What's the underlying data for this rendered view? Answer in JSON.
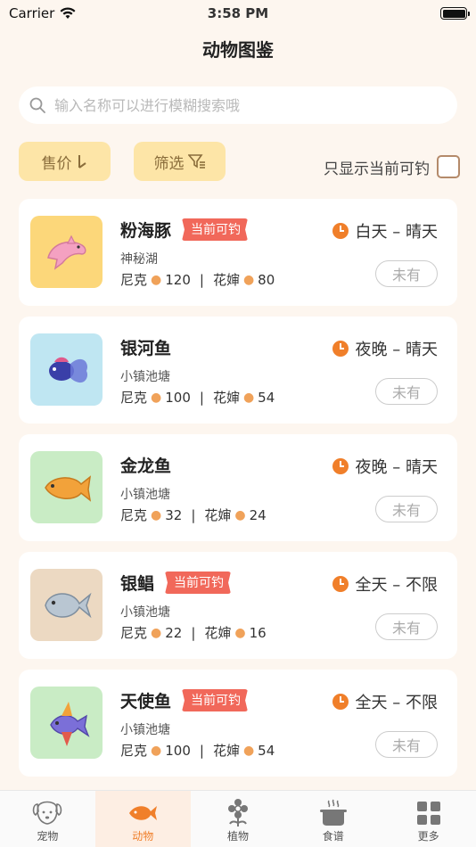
{
  "status": {
    "carrier": "Carrier",
    "time": "3:58 PM"
  },
  "nav": {
    "title": "动物图鉴"
  },
  "search": {
    "placeholder": "输入名称可以进行模糊搜索哦"
  },
  "filters": {
    "price_label": "售价",
    "filter_label": "筛选",
    "only_current_label": "只显示当前可钓"
  },
  "animals": [
    {
      "name": "粉海豚",
      "badge": "当前可钓",
      "location": "神秘湖",
      "time": "白天 – 晴天",
      "owned": "未有",
      "seller1": "尼克",
      "price1": "120",
      "seller2": "花婶",
      "price2": "80",
      "thumb_color": "#fcd77a"
    },
    {
      "name": "银河鱼",
      "badge": "",
      "location": "小镇池塘",
      "time": "夜晚 – 晴天",
      "owned": "未有",
      "seller1": "尼克",
      "price1": "100",
      "seller2": "花婶",
      "price2": "54",
      "thumb_color": "#bfe6f2"
    },
    {
      "name": "金龙鱼",
      "badge": "",
      "location": "小镇池塘",
      "time": "夜晚 – 晴天",
      "owned": "未有",
      "seller1": "尼克",
      "price1": "32",
      "seller2": "花婶",
      "price2": "24",
      "thumb_color": "#c9ecc5"
    },
    {
      "name": "银鲳",
      "badge": "当前可钓",
      "location": "小镇池塘",
      "time": "全天 – 不限",
      "owned": "未有",
      "seller1": "尼克",
      "price1": "22",
      "seller2": "花婶",
      "price2": "16",
      "thumb_color": "#ecd9c2"
    },
    {
      "name": "天使鱼",
      "badge": "当前可钓",
      "location": "小镇池塘",
      "time": "全天 – 不限",
      "owned": "未有",
      "seller1": "尼克",
      "price1": "100",
      "seller2": "花婶",
      "price2": "54",
      "thumb_color": "#c9ecc5"
    }
  ],
  "tabs": [
    {
      "label": "宠物",
      "icon": "dog-icon",
      "active": false
    },
    {
      "label": "动物",
      "icon": "fish-icon",
      "active": true
    },
    {
      "label": "植物",
      "icon": "flower-icon",
      "active": false
    },
    {
      "label": "食谱",
      "icon": "pot-icon",
      "active": false
    },
    {
      "label": "更多",
      "icon": "grid-icon",
      "active": false
    }
  ],
  "colors": {
    "accent": "#f07f2a",
    "badge": "#f1685a",
    "button_bg": "#fde5a7"
  }
}
